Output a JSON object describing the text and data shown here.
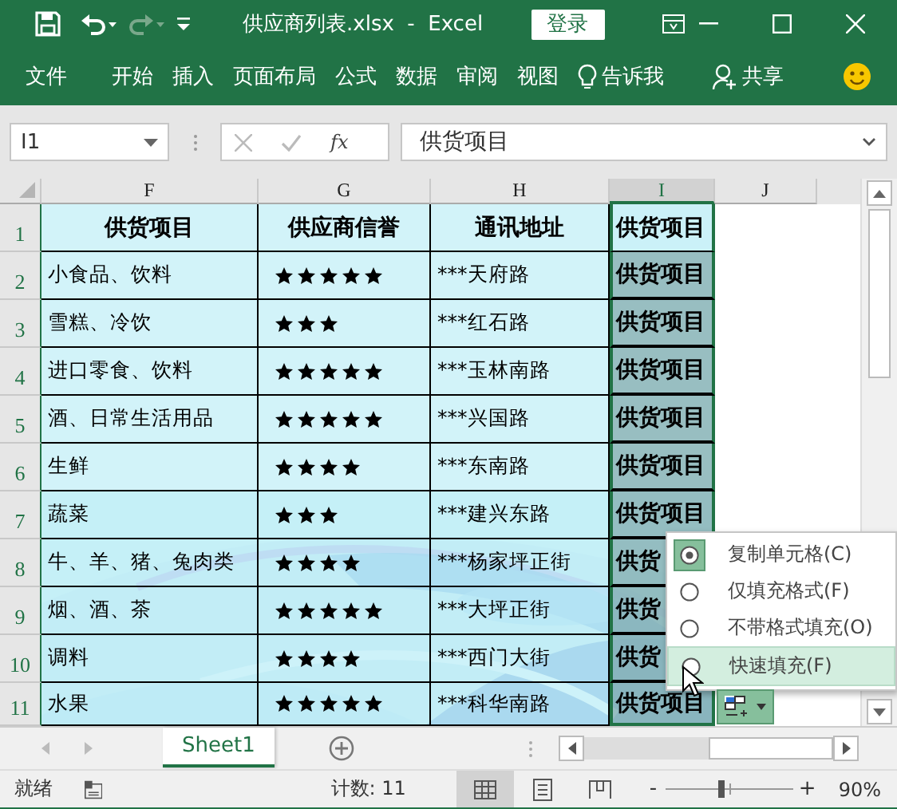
{
  "window": {
    "title": "供应商列表.xlsx  -  Excel",
    "login_button": "登录"
  },
  "ribbon": {
    "tabs": [
      {
        "label": "文件",
        "kind": "file"
      },
      {
        "label": "开始",
        "kind": "tab"
      },
      {
        "label": "插入",
        "kind": "tab"
      },
      {
        "label": "页面布局",
        "kind": "tab"
      },
      {
        "label": "公式",
        "kind": "tab"
      },
      {
        "label": "数据",
        "kind": "tab"
      },
      {
        "label": "审阅",
        "kind": "tab"
      },
      {
        "label": "视图",
        "kind": "tab"
      },
      {
        "label": "告诉我",
        "kind": "search"
      },
      {
        "label": "共享",
        "kind": "share"
      }
    ]
  },
  "formula_bar": {
    "name_box": "I1",
    "fx": "fx",
    "value": "供货项目"
  },
  "grid": {
    "columns": [
      "F",
      "G",
      "H",
      "I",
      "J"
    ],
    "header": {
      "row": "1",
      "item": "供货项目",
      "rating": "供应商信誉",
      "address": "通讯地址",
      "fill": "供货项目"
    },
    "rows": [
      {
        "row": "2",
        "item": "小食品、饮料",
        "stars": 5,
        "address": "***天府路",
        "fill": "供货项目"
      },
      {
        "row": "3",
        "item": "雪糕、冷饮",
        "stars": 3,
        "address": "***红石路",
        "fill": "供货项目"
      },
      {
        "row": "4",
        "item": "进口零食、饮料",
        "stars": 5,
        "address": "***玉林南路",
        "fill": "供货项目"
      },
      {
        "row": "5",
        "item": "酒、日常生活用品",
        "stars": 5,
        "address": "***兴国路",
        "fill": "供货项目"
      },
      {
        "row": "6",
        "item": "生鲜",
        "stars": 4,
        "address": "***东南路",
        "fill": "供货项目"
      },
      {
        "row": "7",
        "item": "蔬菜",
        "stars": 3,
        "address": "***建兴东路",
        "fill": "供货项目"
      },
      {
        "row": "8",
        "item": "牛、羊、猪、兔肉类",
        "stars": 4,
        "address": "***杨家坪正街",
        "fill": "供货"
      },
      {
        "row": "9",
        "item": "烟、酒、茶",
        "stars": 5,
        "address": "***大坪正街",
        "fill": "供货"
      },
      {
        "row": "10",
        "item": "调料",
        "stars": 4,
        "address": "***西门大街",
        "fill": "供货"
      },
      {
        "row": "11",
        "item": "水果",
        "stars": 5,
        "address": "***科华南路",
        "fill": "供货项目"
      }
    ]
  },
  "fill_menu": {
    "options": [
      {
        "label": "复制单元格(C)",
        "selected": true,
        "highlighted": false
      },
      {
        "label": "仅填充格式(F)",
        "selected": false,
        "highlighted": false
      },
      {
        "label": "不带格式填充(O)",
        "selected": false,
        "highlighted": false
      },
      {
        "label": "快速填充(F)",
        "selected": false,
        "highlighted": true
      }
    ]
  },
  "sheet_tabs": [
    {
      "label": "Sheet1",
      "selected": true
    }
  ],
  "status_bar": {
    "status": "就绪",
    "count": "计数: 11",
    "views": [
      {
        "kind": "normal",
        "selected": true
      },
      {
        "kind": "page-layout",
        "selected": false
      },
      {
        "kind": "page-break",
        "selected": false
      }
    ],
    "zoom_out": "-",
    "zoom_in": "+",
    "zoom": {
      "level": 0.43
    },
    "zoom_label": "90%"
  }
}
